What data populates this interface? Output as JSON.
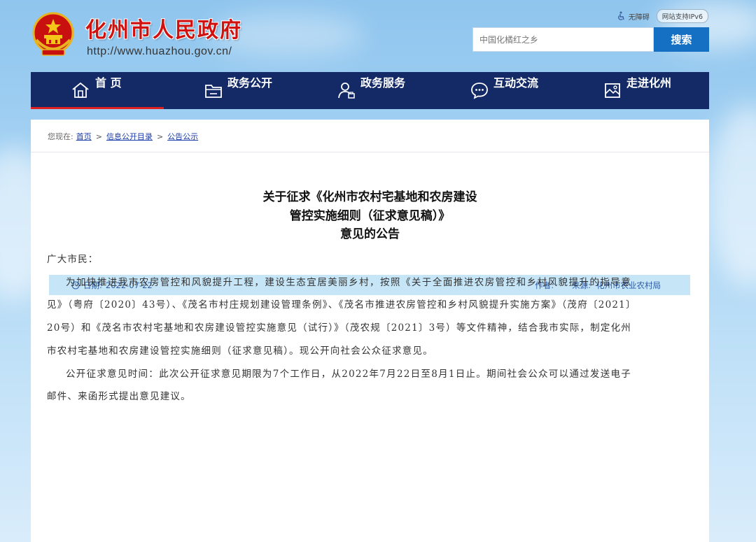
{
  "header": {
    "title": "化州市人民政府",
    "url": "http://www.huazhou.gov.cn/",
    "accessibility_label": "无障碍",
    "ipv6_badge": "网站支持IPv6",
    "search_placeholder": "中国化橘红之乡",
    "search_button": "搜索"
  },
  "nav": {
    "items": [
      {
        "label": "首 页",
        "icon": "home-icon"
      },
      {
        "label": "政务公开",
        "icon": "folder-icon"
      },
      {
        "label": "政务服务",
        "icon": "user-service-icon"
      },
      {
        "label": "互动交流",
        "icon": "chat-icon"
      },
      {
        "label": "走进化州",
        "icon": "picture-icon"
      }
    ],
    "active_index": 0
  },
  "breadcrumb": {
    "prefix": "您现在:",
    "items": [
      "首页",
      "信息公开目录",
      "公告公示"
    ],
    "separator": ">"
  },
  "article": {
    "title_lines": [
      "关于征求《化州市农村宅基地和农房建设",
      "管控实施细则（征求意见稿）》",
      "意见的公告"
    ],
    "date_label": "日期:",
    "date": "2022-07-22",
    "author_label": "作者:",
    "author": "",
    "source_label": "来源:",
    "source": "化州市农业农村局",
    "greeting": "广大市民：",
    "paragraphs": [
      "为加快推进我市农房管控和风貌提升工程，建设生态宜居美丽乡村，按照《关于全面推进农房管控和乡村风貌提升的指导意见》（粤府〔2020〕43号）、《茂名市村庄规划建设管理条例》、《茂名市推进农房管控和乡村风貌提升实施方案》（茂府〔2021〕20号）和《茂名市农村宅基地和农房建设管控实施意见（试行）》（茂农规〔2021〕3号）等文件精神，结合我市实际，制定化州市农村宅基地和农房建设管控实施细则（征求意见稿）。现公开向社会公众征求意见。",
      "公开征求意见时间：此次公开征求意见期限为7个工作日，从2022年7月22日至8月1日止。期间社会公众可以通过发送电子邮件、来函形式提出意见建议。"
    ]
  },
  "colors": {
    "nav_bg": "#142a67",
    "nav_active_underline": "#e02020",
    "title_red": "#d0110f",
    "search_button": "#1570c4",
    "meta_bar": "#c6e6f8"
  }
}
